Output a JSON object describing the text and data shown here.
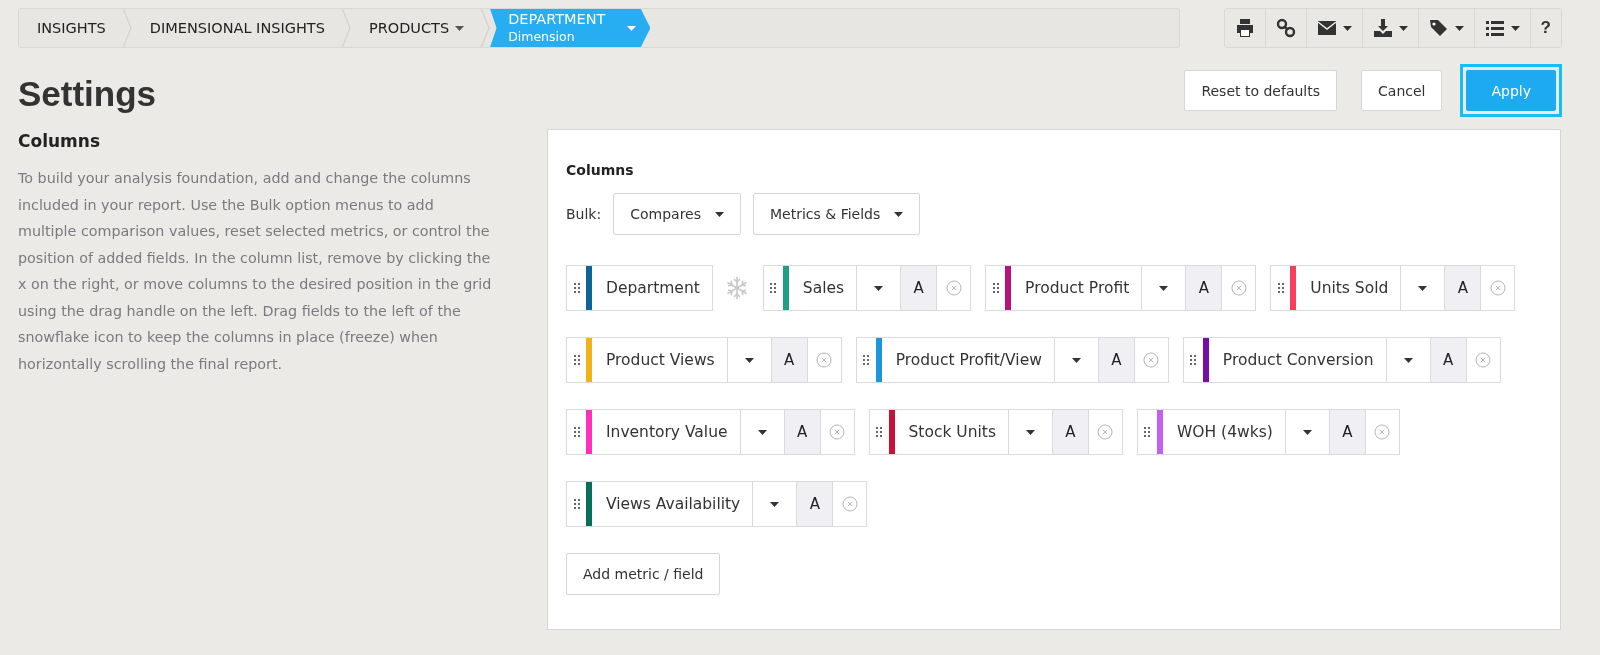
{
  "breadcrumbs": [
    {
      "label": "INSIGHTS",
      "dropdown": false,
      "selected": false
    },
    {
      "label": "DIMENSIONAL INSIGHTS",
      "dropdown": false,
      "selected": false
    },
    {
      "label": "PRODUCTS",
      "dropdown": true,
      "selected": false
    },
    {
      "label": "DEPARTMENT",
      "sublabel": "Dimension",
      "dropdown": true,
      "selected": true
    }
  ],
  "toolbar": [
    {
      "kind": "print",
      "dropdown": false
    },
    {
      "kind": "link",
      "dropdown": false
    },
    {
      "kind": "mail",
      "dropdown": true
    },
    {
      "kind": "download",
      "dropdown": true
    },
    {
      "kind": "tag",
      "dropdown": true
    },
    {
      "kind": "list",
      "dropdown": true
    },
    {
      "kind": "help",
      "label": "?",
      "dropdown": false
    }
  ],
  "page_title": "Settings",
  "actions": [
    {
      "label": "Reset to defaults",
      "primary": false,
      "highlighted": false
    },
    {
      "label": "Cancel",
      "primary": false,
      "highlighted": false
    },
    {
      "label": "Apply",
      "primary": true,
      "highlighted": true
    }
  ],
  "section": {
    "heading": "Columns",
    "description": "To build your analysis foundation, add and change the columns included in your report. Use the Bulk option menus to add multiple comparison values, reset selected metrics, or control the position of added fields. In the column list, remove by clicking the x on the right, or move columns to the desired position in the grid using the drag handle on the left. Drag fields to the left of the snowflake icon to keep the columns in place (freeze) when horizontally scrolling the final report."
  },
  "panel": {
    "heading": "Columns",
    "bulk_label": "Bulk:",
    "bulk_menus": [
      "Compares",
      "Metrics & Fields"
    ],
    "columns": [
      {
        "kind": "dimension",
        "name": "Department",
        "color": "#0e6496"
      },
      {
        "kind": "metric",
        "name": "Sales",
        "color": "#1fa085",
        "badge": "A"
      },
      {
        "kind": "metric",
        "name": "Product Profit",
        "color": "#b8127c",
        "badge": "A"
      },
      {
        "kind": "metric",
        "name": "Units Sold",
        "color": "#f8405c",
        "badge": "A"
      },
      {
        "kind": "metric",
        "name": "Product Views",
        "color": "#f2b21c",
        "badge": "A"
      },
      {
        "kind": "metric",
        "name": "Product Profit/View",
        "color": "#1b96d8",
        "badge": "A"
      },
      {
        "kind": "metric",
        "name": "Product Conversion",
        "color": "#760ea6",
        "badge": "A"
      },
      {
        "kind": "metric",
        "name": "Inventory Value",
        "color": "#ff33bb",
        "badge": "A"
      },
      {
        "kind": "metric",
        "name": "Stock Units",
        "color": "#c8103c",
        "badge": "A"
      },
      {
        "kind": "metric",
        "name": "WOH (4wks)",
        "color": "#c45ff5",
        "badge": "A"
      },
      {
        "kind": "metric",
        "name": "Views Availability",
        "color": "#077058",
        "badge": "A"
      }
    ],
    "add_button": "Add metric / field"
  }
}
